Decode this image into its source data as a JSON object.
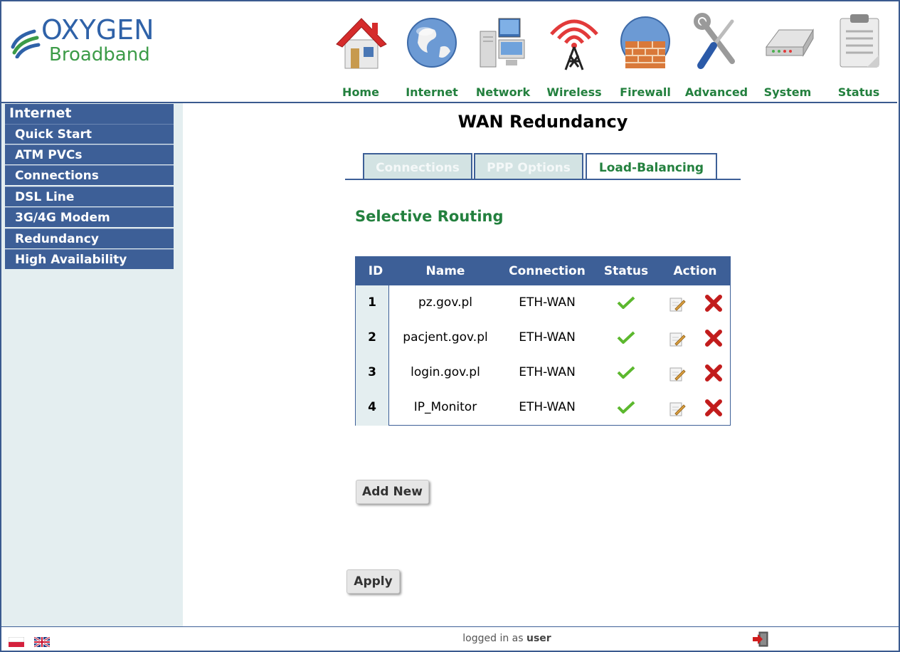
{
  "brand": {
    "line1": "OXYGEN",
    "line2": "Broadband"
  },
  "nav": [
    {
      "label": "Home",
      "icon": "home-icon"
    },
    {
      "label": "Internet",
      "icon": "globe-icon"
    },
    {
      "label": "Network",
      "icon": "network-icon"
    },
    {
      "label": "Wireless",
      "icon": "antenna-icon"
    },
    {
      "label": "Firewall",
      "icon": "firewall-icon"
    },
    {
      "label": "Advanced",
      "icon": "tools-icon"
    },
    {
      "label": "System",
      "icon": "modem-icon"
    },
    {
      "label": "Status",
      "icon": "clipboard-icon"
    }
  ],
  "sidebar": {
    "title": "Internet",
    "items": [
      {
        "label": "Quick Start"
      },
      {
        "label": "ATM PVCs"
      },
      {
        "label": "Connections"
      },
      {
        "label": "DSL Line"
      },
      {
        "label": "3G/4G Modem"
      },
      {
        "label": "Redundancy"
      },
      {
        "label": "High Availability"
      }
    ]
  },
  "page": {
    "title": "WAN Redundancy",
    "section_title": "Selective Routing"
  },
  "tabs": [
    {
      "label": "Connections",
      "active": false
    },
    {
      "label": "PPP Options",
      "active": false
    },
    {
      "label": "Load-Balancing",
      "active": true
    }
  ],
  "table": {
    "headers": {
      "id": "ID",
      "name": "Name",
      "connection": "Connection",
      "status": "Status",
      "action": "Action"
    },
    "rows": [
      {
        "id": "1",
        "name": "pz.gov.pl",
        "connection": "ETH-WAN",
        "status": "check-icon"
      },
      {
        "id": "2",
        "name": "pacjent.gov.pl",
        "connection": "ETH-WAN",
        "status": "check-icon"
      },
      {
        "id": "3",
        "name": "login.gov.pl",
        "connection": "ETH-WAN",
        "status": "check-icon"
      },
      {
        "id": "4",
        "name": "IP_Monitor",
        "connection": "ETH-WAN",
        "status": "check-icon"
      }
    ]
  },
  "buttons": {
    "add_new": "Add New",
    "apply": "Apply"
  },
  "footer": {
    "logged_in_prefix": "logged in as",
    "user": "user"
  },
  "colors": {
    "accent_blue": "#3d5f97",
    "accent_green": "#23803e",
    "sidebar_bg": "#e4eef0"
  }
}
